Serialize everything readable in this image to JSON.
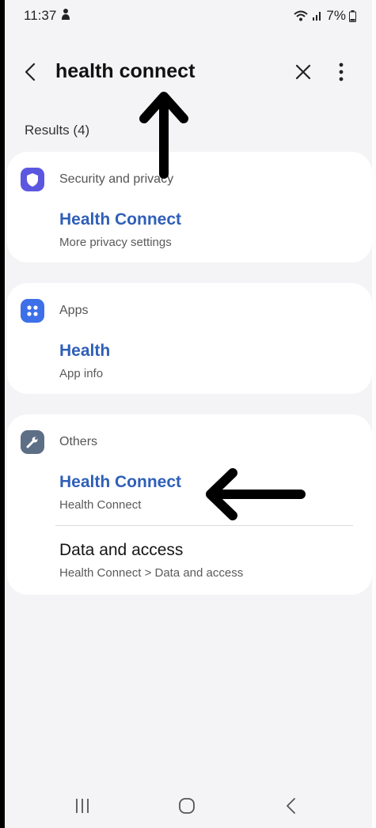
{
  "status_bar": {
    "time": "11:37",
    "battery": "7%",
    "icons": [
      "person-icon",
      "wifi-icon",
      "signal-icon",
      "battery-icon"
    ]
  },
  "app_bar": {
    "query": "health connect",
    "icons": [
      "back-icon",
      "close-icon",
      "more-vert-icon"
    ]
  },
  "results_label": "Results (4)",
  "cards": [
    {
      "category": "Security and privacy",
      "icon": "shield-icon",
      "icon_color": "#5b57e0",
      "items": [
        {
          "title": "Health Connect",
          "subtitle": "More privacy settings"
        }
      ]
    },
    {
      "category": "Apps",
      "icon": "apps-grid-icon",
      "icon_color": "#3d6fe8",
      "items": [
        {
          "title": "Health",
          "subtitle": "App info"
        }
      ]
    },
    {
      "category": "Others",
      "icon": "wrench-icon",
      "icon_color": "#5d6f86",
      "items": [
        {
          "title": "Health Connect",
          "subtitle": "Health Connect"
        },
        {
          "title": "Data and access",
          "subtitle": "Health Connect > Data and access"
        }
      ]
    }
  ],
  "nav_bar": {
    "icons": [
      "recents-icon",
      "home-icon",
      "back-nav-icon"
    ]
  },
  "colors": {
    "link_blue": "#2f5fb8",
    "background": "#f4f4f6",
    "card": "#ffffff"
  }
}
